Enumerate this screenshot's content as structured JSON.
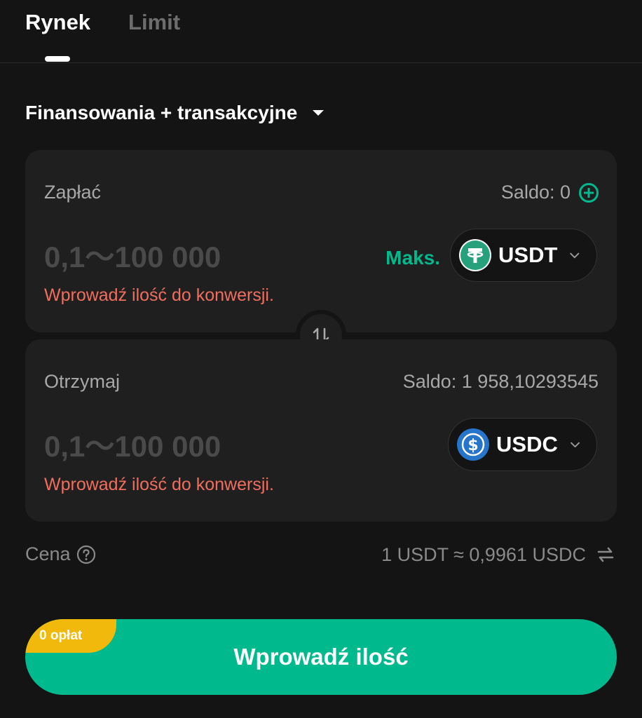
{
  "tabs": [
    {
      "label": "Rynek",
      "active": true
    },
    {
      "label": "Limit",
      "active": false
    }
  ],
  "account": {
    "label": "Finansowania + transakcyjne"
  },
  "pay": {
    "label": "Zapłać",
    "balance": "Saldo: 0",
    "placeholder": "0,1〜100 000",
    "error": "Wprowadź ilość do konwersji.",
    "max_label": "Maks.",
    "coin": "USDT",
    "coin_icon": "tether-icon"
  },
  "receive": {
    "label": "Otrzymaj",
    "balance": "Saldo: 1 958,10293545",
    "placeholder": "0,1〜100 000",
    "error": "Wprowadź ilość do konwersji.",
    "coin": "USDC",
    "coin_icon": "usdc-icon"
  },
  "price": {
    "label": "Cena",
    "value": "1 USDT ≈ 0,9961 USDC"
  },
  "submit": {
    "label": "Wprowadź ilość",
    "fee_badge": "0 opłat"
  },
  "colors": {
    "accent": "#00b98c",
    "error": "#f06e5e",
    "badge": "#f0b90b",
    "background": "#141414",
    "card": "#1f1f1f"
  }
}
